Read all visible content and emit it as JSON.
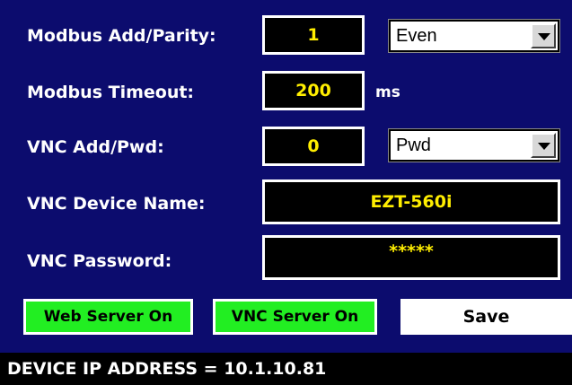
{
  "rows": {
    "modbus_add_parity": {
      "label": "Modbus Add/Parity:",
      "address": "1",
      "parity": "Even"
    },
    "modbus_timeout": {
      "label": "Modbus Timeout:",
      "value": "200",
      "unit": "ms"
    },
    "vnc_add_pwd": {
      "label": "VNC Add/Pwd:",
      "address": "0",
      "mode": "Pwd"
    },
    "vnc_device_name": {
      "label": "VNC Device Name:",
      "value": "EZT-560i"
    },
    "vnc_password": {
      "label": "VNC Password:",
      "value": "*****"
    }
  },
  "buttons": {
    "web_server": "Web Server On",
    "vnc_server": "VNC Server On",
    "save": "Save"
  },
  "status": {
    "ip_text": "DEVICE IP ADDRESS = 10.1.10.81"
  },
  "colors": {
    "background": "#0c0c6e",
    "value_text": "#ffee00",
    "button_on": "#22ee22"
  }
}
